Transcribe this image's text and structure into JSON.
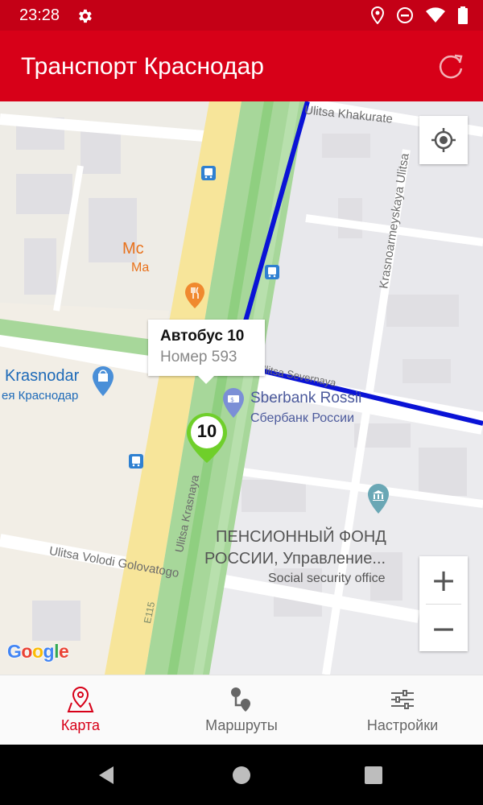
{
  "status_bar": {
    "time": "23:28",
    "icons_left": [
      "gear-icon"
    ],
    "icons_right": [
      "location-icon",
      "do-not-disturb-icon",
      "wifi-icon",
      "battery-icon"
    ]
  },
  "app_bar": {
    "title": "Транспорт Краснодар",
    "refresh_icon": "refresh-icon"
  },
  "map": {
    "popup": {
      "title": "Автобус 10",
      "subtitle": "Номер 593"
    },
    "bus_marker": {
      "route_number": "10"
    },
    "street_labels": {
      "khakurate": "Ulitsa Khakurate",
      "krasnoarmeyskaya": "Krasnoarmeyskaya Ulitsa",
      "severnaya": "Ulitsa Severnaya",
      "krasnaya": "Ulitsa Krasnaya",
      "volodi": "Ulitsa Volodi Golovatogo",
      "highway": "E115"
    },
    "poi": {
      "mc_line1": "Mc",
      "mc_line2": "Ma",
      "krasnodar_en": "Krasnodar",
      "krasnodar_ru": "ея Краснодар",
      "sberbank_en": "Sberbank Rossii",
      "sberbank_ru": "Сбербанк России",
      "pension_line1": "ПЕНСИОННЫЙ ФОНД",
      "pension_line2": "РОССИИ, Управление...",
      "pension_type": "Social security office"
    },
    "route_color": "#0a13d6",
    "google_logo": "Google",
    "controls": {
      "zoom_in": "+",
      "zoom_out": "−"
    }
  },
  "bottom_nav": {
    "items": [
      {
        "label": "Карта",
        "icon": "map-pin-icon",
        "active": true
      },
      {
        "label": "Маршруты",
        "icon": "routes-icon",
        "active": false
      },
      {
        "label": "Настройки",
        "icon": "settings-sliders-icon",
        "active": false
      }
    ]
  },
  "colors": {
    "primary": "#d70018",
    "status_bar": "#c40016",
    "active_tab": "#d70018"
  }
}
